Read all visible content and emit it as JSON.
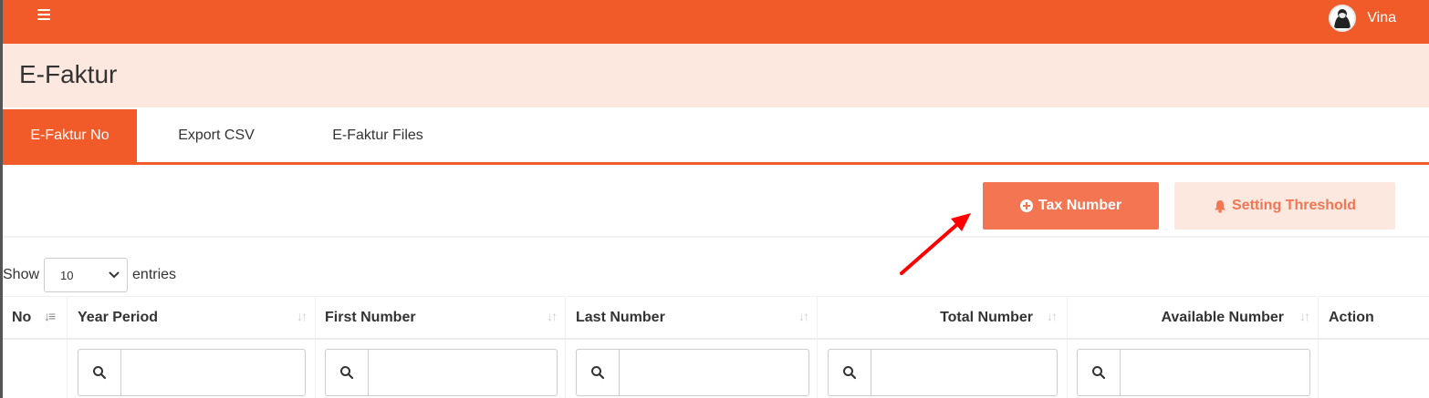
{
  "header": {
    "username": "Vina"
  },
  "page": {
    "title": "E-Faktur"
  },
  "tabs": [
    {
      "label": "E-Faktur No",
      "active": true
    },
    {
      "label": "Export CSV",
      "active": false
    },
    {
      "label": "E-Faktur Files",
      "active": false
    }
  ],
  "actions": {
    "tax_number_label": "Tax Number",
    "setting_threshold_label": "Setting Threshold"
  },
  "length_menu": {
    "show_label": "Show",
    "value": "10",
    "entries_label": "entries"
  },
  "table": {
    "columns": [
      "No",
      "Year Period",
      "First Number",
      "Last Number",
      "Total Number",
      "Available Number",
      "Action"
    ],
    "filters": [
      {
        "placeholder": ""
      },
      {
        "placeholder": ""
      },
      {
        "placeholder": ""
      },
      {
        "placeholder": ""
      },
      {
        "placeholder": ""
      }
    ]
  },
  "colors": {
    "brand": "#f15a29",
    "header_tint": "#fde8df",
    "button_primary": "#f47551",
    "annotation_arrow": "#ff0000"
  },
  "icons": {
    "menu": "hamburger-icon",
    "user": "user-avatar-icon",
    "add": "plus-circle-icon",
    "bell": "bell-icon",
    "sort": "sort-icon",
    "search": "search-icon",
    "dropdown": "chevron-down-icon"
  }
}
